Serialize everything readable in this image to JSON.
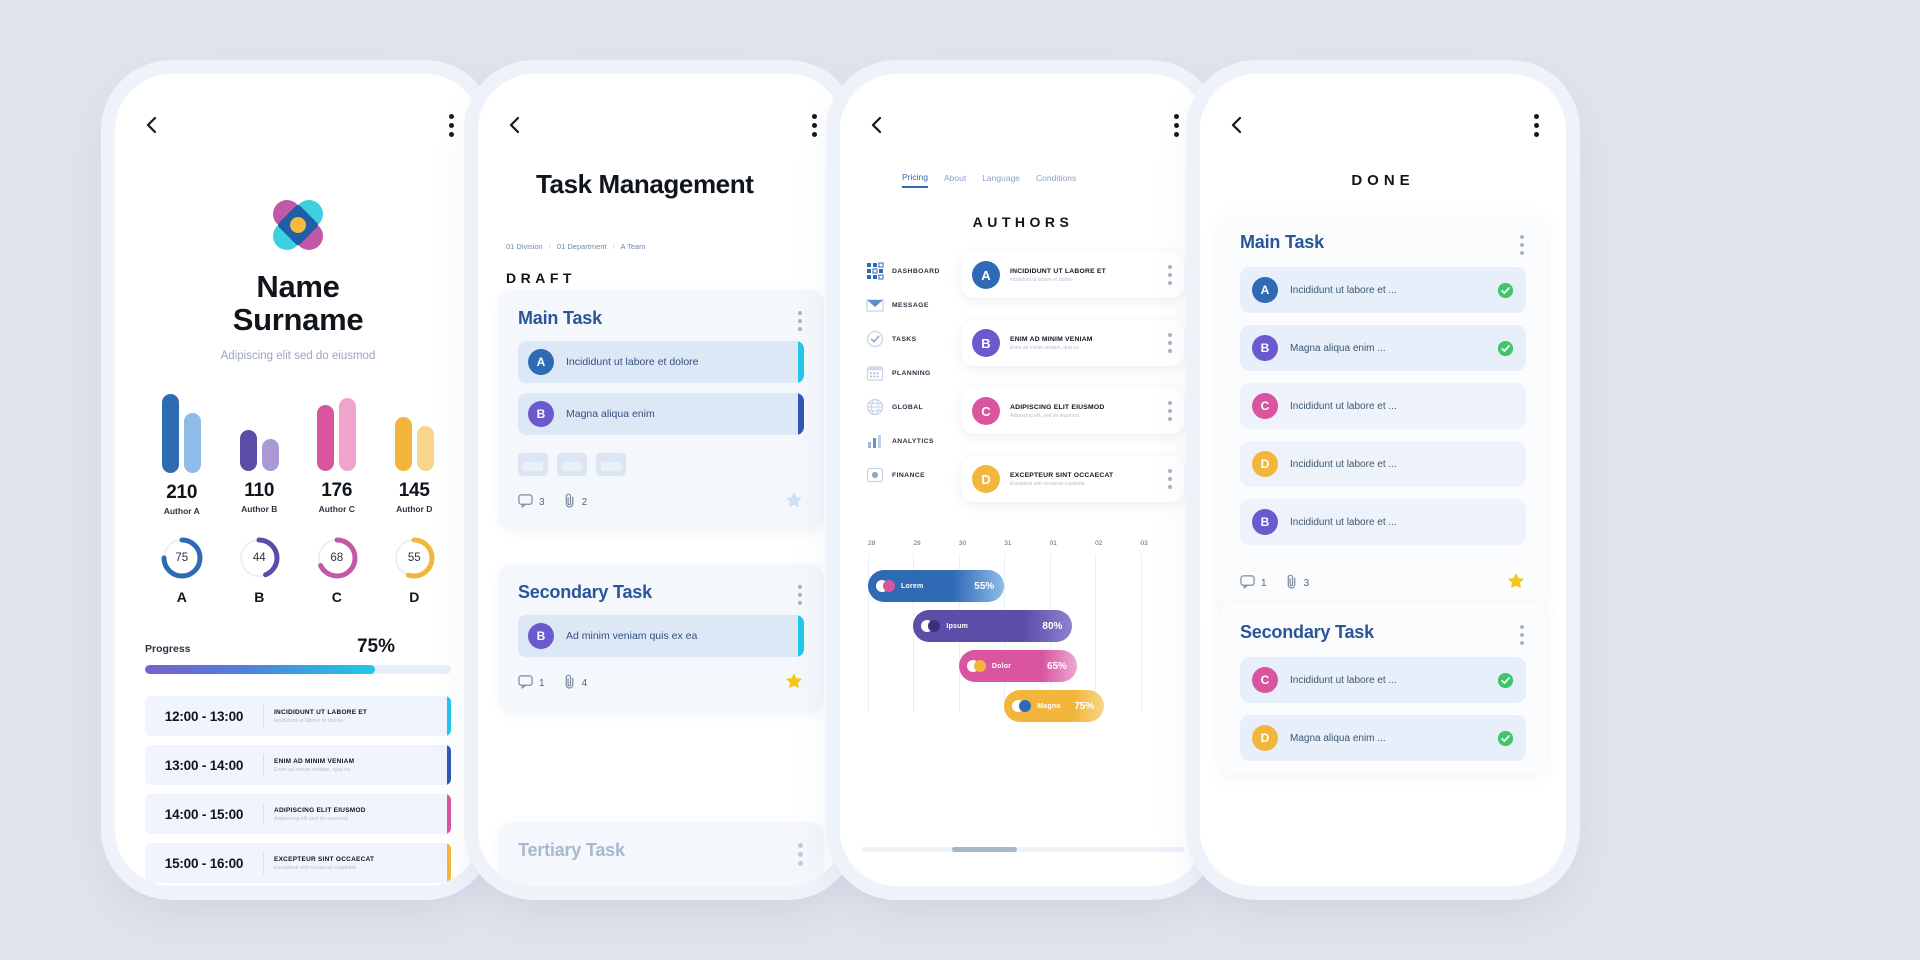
{
  "palette": {
    "blue": "#2f6ab5",
    "blue_light": "#8ebbe8",
    "purple": "#5b4ea8",
    "purple_light": "#a99ad6",
    "pink": "#d9559f",
    "pink_light": "#f0a3cc",
    "yellow": "#f2b63c",
    "yellow_light": "#f8d58a",
    "teal": "#22c7e8",
    "green": "#3fc56b"
  },
  "phone1": {
    "back_icon": "chevron-left-icon",
    "menu_icon": "kebab-menu-icon",
    "logo_icon": "flower-logo-icon",
    "name": "Name",
    "surname": "Surname",
    "subtitle": "Adipiscing elit sed do eiusmod",
    "chart_data": {
      "type": "bar",
      "title": "",
      "categories": [
        "Author A",
        "Author B",
        "Author C",
        "Author D"
      ],
      "values": [
        210,
        110,
        176,
        145
      ],
      "series": [
        {
          "name": "primary",
          "values": [
            210,
            110,
            176,
            145
          ]
        },
        {
          "name": "secondary",
          "values": [
            160,
            86,
            196,
            120
          ]
        }
      ],
      "ylabel": "",
      "xlabel": "",
      "ylim": [
        0,
        240
      ]
    },
    "donuts": [
      {
        "label": "A",
        "value": 75,
        "color": "#2f6ab5"
      },
      {
        "label": "B",
        "value": 44,
        "color": "#5b4ea8"
      },
      {
        "label": "C",
        "value": 68,
        "color": "#c158a8"
      },
      {
        "label": "D",
        "value": 55,
        "color": "#f2b63c"
      }
    ],
    "progress": {
      "label": "Progress",
      "value": "75%",
      "percent": 75
    },
    "schedule": [
      {
        "time": "12:00 - 13:00",
        "title": "INCIDIDUNT UT LABORE ET",
        "desc": "incididunt ut labore et dolore",
        "accent": "#22c7e8"
      },
      {
        "time": "13:00 - 14:00",
        "title": "ENIM AD MINIM VENIAM",
        "desc": "Enim ad minim veniam, quis ex",
        "accent": "#2f57b5"
      },
      {
        "time": "14:00 - 15:00",
        "title": "ADIPISCING ELIT EIUSMOD",
        "desc": "Adipiscing elit sed do eiusmod",
        "accent": "#d9559f"
      },
      {
        "time": "15:00 - 16:00",
        "title": "EXCEPTEUR SINT OCCAECAT",
        "desc": "Excepteur sint occaecat cupidatat",
        "accent": "#f2b63c"
      }
    ]
  },
  "phone2": {
    "back_icon": "chevron-left-icon",
    "menu_icon": "kebab-menu-icon",
    "title": "Task Management",
    "breadcrumb": {
      "item1": "01 Division",
      "item2": "01 Department",
      "item3": "A Team",
      "separator": "/"
    },
    "section_label": "DRAFT",
    "cards": [
      {
        "title": "Main Task",
        "rows": [
          {
            "avatar": "A",
            "avatar_color": "#2f6ab5",
            "text": "Incididunt ut labore et dolore",
            "accent": "#22c7e8"
          },
          {
            "avatar": "B",
            "avatar_color": "#6a5acd",
            "text": "Magna aliqua enim",
            "accent": "#2f57b5"
          }
        ],
        "comments": "3",
        "attachments": "2",
        "starred": false
      },
      {
        "title": "Secondary Task",
        "rows": [
          {
            "avatar": "B",
            "avatar_color": "#6a5acd",
            "text": "Ad minim veniam  quis ex ea",
            "accent": "#22c7e8"
          }
        ],
        "comments": "1",
        "attachments": "4",
        "starred": true
      },
      {
        "title": "Tertiary Task",
        "rows": [],
        "comments": "",
        "attachments": "",
        "starred": false
      }
    ],
    "comment_icon": "comment-icon",
    "attach_icon": "paperclip-icon",
    "star_icon": "star-icon"
  },
  "phone3": {
    "back_icon": "chevron-left-icon",
    "menu_icon": "kebab-menu-icon",
    "tabs": [
      {
        "label": "Pricing",
        "active": true
      },
      {
        "label": "About",
        "active": false
      },
      {
        "label": "Language",
        "active": false
      },
      {
        "label": "Conditions",
        "active": false
      }
    ],
    "heading": "AUTHORS",
    "nav": [
      {
        "label": "DASHBOARD",
        "icon": "grid-icon"
      },
      {
        "label": "MESSAGE",
        "icon": "envelope-icon"
      },
      {
        "label": "TASKS",
        "icon": "check-circle-icon"
      },
      {
        "label": "PLANNING",
        "icon": "calendar-icon"
      },
      {
        "label": "GLOBAL",
        "icon": "globe-icon"
      },
      {
        "label": "ANALYTICS",
        "icon": "bar-chart-icon"
      },
      {
        "label": "FINANCE",
        "icon": "coin-icon"
      }
    ],
    "authors": [
      {
        "avatar": "A",
        "avatar_color": "#2f6ab5",
        "title": "INCIDIDUNT UT LABORE ET",
        "desc": "incididunt ut labore et dolore"
      },
      {
        "avatar": "B",
        "avatar_color": "#6a5acd",
        "title": "ENIM AD MINIM VENIAM",
        "desc": "Enim ad minim veniam, quis ex"
      },
      {
        "avatar": "C",
        "avatar_color": "#d9559f",
        "title": "ADIPISCING ELIT EIUSMOD",
        "desc": "Adipiscing elit, sed do eiusmod"
      },
      {
        "avatar": "D",
        "avatar_color": "#f2b63c",
        "title": "EXCEPTEUR SINT OCCAECAT",
        "desc": "Excepteur sint occaecat cupidatat"
      }
    ],
    "chart_data": {
      "type": "bar",
      "orientation": "horizontal",
      "title": "",
      "x_ticks": [
        "28",
        "29",
        "30",
        "31",
        "01",
        "02",
        "03"
      ],
      "categories": [
        "Lorem",
        "Ipsum",
        "Dolor",
        "Magna"
      ],
      "values": [
        55,
        80,
        65,
        75
      ],
      "labels": [
        "55%",
        "80%",
        "65%",
        "75%"
      ],
      "colors": [
        "#2f6ab5",
        "#5b4ea8",
        "#d9559f",
        "#f2b63c"
      ],
      "bar_starts": [
        0,
        1,
        2,
        3
      ],
      "bar_ends": [
        3.0,
        4.5,
        4.6,
        5.2
      ],
      "grid": true,
      "legend": "none"
    }
  },
  "phone4": {
    "back_icon": "chevron-left-icon",
    "menu_icon": "kebab-menu-icon",
    "heading": "DONE",
    "cards": [
      {
        "title": "Main Task",
        "rows": [
          {
            "avatar": "A",
            "avatar_color": "#2f6ab5",
            "text": "Incididunt ut labore et ...",
            "done": true
          },
          {
            "avatar": "B",
            "avatar_color": "#6a5acd",
            "text": "Magna aliqua enim ...",
            "done": true
          },
          {
            "avatar": "C",
            "avatar_color": "#d9559f",
            "text": "Incididunt ut labore et ...",
            "done": false
          },
          {
            "avatar": "D",
            "avatar_color": "#f2b63c",
            "text": "Incididunt ut labore et ...",
            "done": false
          },
          {
            "avatar": "B",
            "avatar_color": "#6a5acd",
            "text": "Incididunt ut labore et ...",
            "done": false
          }
        ],
        "comments": "1",
        "attachments": "3",
        "starred": true
      },
      {
        "title": "Secondary Task",
        "rows": [
          {
            "avatar": "C",
            "avatar_color": "#d9559f",
            "text": "Incididunt ut labore et ...",
            "done": true
          },
          {
            "avatar": "D",
            "avatar_color": "#f2b63c",
            "text": "Magna aliqua enim ...",
            "done": true
          }
        ],
        "comments": "",
        "attachments": "",
        "starred": false
      }
    ],
    "comment_icon": "comment-icon",
    "attach_icon": "paperclip-icon",
    "star_icon": "star-icon",
    "check_icon": "check-circle-icon"
  }
}
